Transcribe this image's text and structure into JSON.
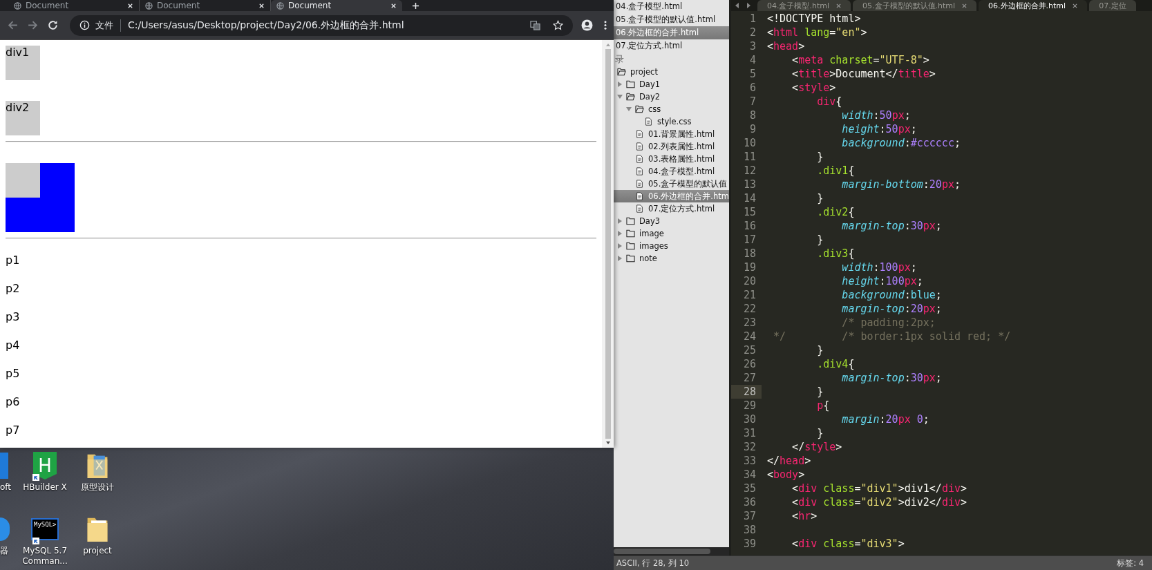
{
  "browser": {
    "tabs": [
      {
        "title": "Document",
        "selected": false
      },
      {
        "title": "Document",
        "selected": false
      },
      {
        "title": "Document",
        "selected": true
      }
    ],
    "address": {
      "scheme_label": "文件",
      "url": "C:/Users/asus/Desktop/project/Day2/06.外边框的合并.html"
    },
    "page": [
      {
        "kind": "box",
        "text": "div1"
      },
      {
        "kind": "box",
        "text": "div2"
      },
      {
        "kind": "rule"
      },
      {
        "kind": "nested"
      },
      {
        "kind": "rule"
      },
      {
        "kind": "para",
        "text": "p1"
      },
      {
        "kind": "para",
        "text": "p2"
      },
      {
        "kind": "para",
        "text": "p3"
      },
      {
        "kind": "para",
        "text": "p4"
      },
      {
        "kind": "para",
        "text": "p5"
      },
      {
        "kind": "para",
        "text": "p6"
      },
      {
        "kind": "para",
        "text": "p7"
      }
    ]
  },
  "desktop": {
    "icons": [
      {
        "label": "oft",
        "kind": "app-square",
        "shortcut": false
      },
      {
        "label": "HBuilder X",
        "kind": "hexagon",
        "glyph": "H",
        "shortcut": true
      },
      {
        "label": "原型设计",
        "kind": "doc-folder",
        "shortcut": false
      },
      {
        "label": "器",
        "kind": "app-circle",
        "shortcut": false
      },
      {
        "label": "MySQL 5.7 Comman...",
        "kind": "terminal",
        "glyph": "MySQL>",
        "shortcut": true
      },
      {
        "label": "project",
        "kind": "folder",
        "shortcut": false
      }
    ]
  },
  "sublime": {
    "open_files": [
      {
        "name": "04.盒子模型.html",
        "selected": false
      },
      {
        "name": "05.盒子模型的默认值.html",
        "selected": false
      },
      {
        "name": "06.外边框的合并.html",
        "selected": true
      },
      {
        "name": "07.定位方式.html",
        "selected": false
      }
    ],
    "folders_header": "录",
    "tree": [
      {
        "name": "project",
        "kind": "folder",
        "expanded": true,
        "selected": false,
        "children": [
          {
            "name": "Day1",
            "kind": "folder",
            "expanded": false,
            "selected": false
          },
          {
            "name": "Day2",
            "kind": "folder",
            "expanded": true,
            "selected": false,
            "children": [
              {
                "name": "css",
                "kind": "folder",
                "expanded": true,
                "selected": false,
                "children": [
                  {
                    "name": "style.css",
                    "kind": "file",
                    "selected": false
                  }
                ]
              },
              {
                "name": "01.背景属性.html",
                "kind": "file",
                "selected": false
              },
              {
                "name": "02.列表属性.html",
                "kind": "file",
                "selected": false
              },
              {
                "name": "03.表格属性.html",
                "kind": "file",
                "selected": false
              },
              {
                "name": "04.盒子模型.html",
                "kind": "file",
                "selected": false
              },
              {
                "name": "05.盒子模型的默认值",
                "kind": "file",
                "selected": false
              },
              {
                "name": "06.外边框的合并.htm",
                "kind": "file",
                "selected": true
              },
              {
                "name": "07.定位方式.html",
                "kind": "file",
                "selected": false
              }
            ]
          },
          {
            "name": "Day3",
            "kind": "folder",
            "expanded": false,
            "selected": false
          },
          {
            "name": "image",
            "kind": "folder",
            "expanded": false,
            "selected": false
          },
          {
            "name": "images",
            "kind": "folder",
            "expanded": false,
            "selected": false
          },
          {
            "name": "note",
            "kind": "folder",
            "expanded": false,
            "selected": false
          }
        ]
      }
    ],
    "editor": {
      "tabs": [
        {
          "title": "04.盒子模型.html",
          "selected": false,
          "closable": true
        },
        {
          "title": "05.盒子模型的默认值.html",
          "selected": false,
          "closable": true
        },
        {
          "title": "06.外边框的合并.html",
          "selected": true,
          "closable": true
        },
        {
          "title": "07.定位",
          "selected": false,
          "closable": false
        }
      ],
      "lines": [
        {
          "n": "1",
          "current": false,
          "tokens": [
            {
              "kind": "p",
              "text": "<!DOCTYPE html>"
            }
          ]
        },
        {
          "n": "2",
          "current": false,
          "tokens": [
            {
              "kind": "p",
              "text": "<"
            },
            {
              "kind": "tag",
              "text": "html"
            },
            {
              "kind": "attr",
              "text": " lang"
            },
            {
              "kind": "p",
              "text": "="
            },
            {
              "kind": "str",
              "text": "\"en\""
            },
            {
              "kind": "p",
              "text": ">"
            }
          ]
        },
        {
          "n": "3",
          "current": false,
          "tokens": [
            {
              "kind": "p",
              "text": "<"
            },
            {
              "kind": "tag",
              "text": "head"
            },
            {
              "kind": "p",
              "text": ">"
            }
          ]
        },
        {
          "n": "4",
          "current": false,
          "tokens": [
            {
              "kind": "p",
              "text": "    <"
            },
            {
              "kind": "tag",
              "text": "meta"
            },
            {
              "kind": "attr",
              "text": " charset"
            },
            {
              "kind": "p",
              "text": "="
            },
            {
              "kind": "str",
              "text": "\"UTF-8\""
            },
            {
              "kind": "p",
              "text": ">"
            }
          ]
        },
        {
          "n": "5",
          "current": false,
          "tokens": [
            {
              "kind": "p",
              "text": "    <"
            },
            {
              "kind": "tag",
              "text": "title"
            },
            {
              "kind": "p",
              "text": ">Document</"
            },
            {
              "kind": "tag",
              "text": "title"
            },
            {
              "kind": "p",
              "text": ">"
            }
          ]
        },
        {
          "n": "6",
          "current": false,
          "tokens": [
            {
              "kind": "p",
              "text": "    <"
            },
            {
              "kind": "tag",
              "text": "style"
            },
            {
              "kind": "p",
              "text": ">"
            }
          ]
        },
        {
          "n": "7",
          "current": false,
          "tokens": [
            {
              "kind": "tag",
              "text": "        div"
            },
            {
              "kind": "p",
              "text": "{"
            }
          ]
        },
        {
          "n": "8",
          "current": false,
          "tokens": [
            {
              "kind": "prop",
              "text": "            width"
            },
            {
              "kind": "p",
              "text": ":"
            },
            {
              "kind": "num",
              "text": "50"
            },
            {
              "kind": "unit",
              "text": "px"
            },
            {
              "kind": "p",
              "text": ";"
            }
          ]
        },
        {
          "n": "9",
          "current": false,
          "tokens": [
            {
              "kind": "prop",
              "text": "            height"
            },
            {
              "kind": "p",
              "text": ":"
            },
            {
              "kind": "num",
              "text": "50"
            },
            {
              "kind": "unit",
              "text": "px"
            },
            {
              "kind": "p",
              "text": ";"
            }
          ]
        },
        {
          "n": "10",
          "current": false,
          "tokens": [
            {
              "kind": "prop",
              "text": "            background"
            },
            {
              "kind": "p",
              "text": ":"
            },
            {
              "kind": "num",
              "text": "#cccccc"
            },
            {
              "kind": "p",
              "text": ";"
            }
          ]
        },
        {
          "n": "11",
          "current": false,
          "tokens": [
            {
              "kind": "p",
              "text": "        }"
            }
          ]
        },
        {
          "n": "12",
          "current": false,
          "tokens": [
            {
              "kind": "sel",
              "text": "        .div1"
            },
            {
              "kind": "p",
              "text": "{"
            }
          ]
        },
        {
          "n": "13",
          "current": false,
          "tokens": [
            {
              "kind": "prop",
              "text": "            margin-bottom"
            },
            {
              "kind": "p",
              "text": ":"
            },
            {
              "kind": "num",
              "text": "20"
            },
            {
              "kind": "unit",
              "text": "px"
            },
            {
              "kind": "p",
              "text": ";"
            }
          ]
        },
        {
          "n": "14",
          "current": false,
          "tokens": [
            {
              "kind": "p",
              "text": "        }"
            }
          ]
        },
        {
          "n": "15",
          "current": false,
          "tokens": [
            {
              "kind": "sel",
              "text": "        .div2"
            },
            {
              "kind": "p",
              "text": "{"
            }
          ]
        },
        {
          "n": "16",
          "current": false,
          "tokens": [
            {
              "kind": "prop",
              "text": "            margin-top"
            },
            {
              "kind": "p",
              "text": ":"
            },
            {
              "kind": "num",
              "text": "30"
            },
            {
              "kind": "unit",
              "text": "px"
            },
            {
              "kind": "p",
              "text": ";"
            }
          ]
        },
        {
          "n": "17",
          "current": false,
          "tokens": [
            {
              "kind": "p",
              "text": "        }"
            }
          ]
        },
        {
          "n": "18",
          "current": false,
          "tokens": [
            {
              "kind": "sel",
              "text": "        .div3"
            },
            {
              "kind": "p",
              "text": "{"
            }
          ]
        },
        {
          "n": "19",
          "current": false,
          "tokens": [
            {
              "kind": "prop",
              "text": "            width"
            },
            {
              "kind": "p",
              "text": ":"
            },
            {
              "kind": "num",
              "text": "100"
            },
            {
              "kind": "unit",
              "text": "px"
            },
            {
              "kind": "p",
              "text": ";"
            }
          ]
        },
        {
          "n": "20",
          "current": false,
          "tokens": [
            {
              "kind": "prop",
              "text": "            height"
            },
            {
              "kind": "p",
              "text": ":"
            },
            {
              "kind": "num",
              "text": "100"
            },
            {
              "kind": "unit",
              "text": "px"
            },
            {
              "kind": "p",
              "text": ";"
            }
          ]
        },
        {
          "n": "21",
          "current": false,
          "tokens": [
            {
              "kind": "prop",
              "text": "            background"
            },
            {
              "kind": "p",
              "text": ":"
            },
            {
              "kind": "kw",
              "text": "blue"
            },
            {
              "kind": "p",
              "text": ";"
            }
          ]
        },
        {
          "n": "22",
          "current": false,
          "tokens": [
            {
              "kind": "prop",
              "text": "            margin-top"
            },
            {
              "kind": "p",
              "text": ":"
            },
            {
              "kind": "num",
              "text": "20"
            },
            {
              "kind": "unit",
              "text": "px"
            },
            {
              "kind": "p",
              "text": ";"
            }
          ]
        },
        {
          "n": "23",
          "current": false,
          "tokens": [
            {
              "kind": "cmt",
              "text": "            /* padding:2px;"
            }
          ]
        },
        {
          "n": "24",
          "current": false,
          "tokens": [
            {
              "kind": "cmt",
              "text": " */         /* border:1px solid red; */"
            }
          ]
        },
        {
          "n": "25",
          "current": false,
          "tokens": [
            {
              "kind": "p",
              "text": "        }"
            }
          ]
        },
        {
          "n": "26",
          "current": false,
          "tokens": [
            {
              "kind": "sel",
              "text": "        .div4"
            },
            {
              "kind": "p",
              "text": "{"
            }
          ]
        },
        {
          "n": "27",
          "current": false,
          "tokens": [
            {
              "kind": "prop",
              "text": "            margin-top"
            },
            {
              "kind": "p",
              "text": ":"
            },
            {
              "kind": "num",
              "text": "30"
            },
            {
              "kind": "unit",
              "text": "px"
            },
            {
              "kind": "p",
              "text": ";"
            }
          ]
        },
        {
          "n": "28",
          "current": true,
          "tokens": [
            {
              "kind": "p",
              "text": "        }"
            }
          ]
        },
        {
          "n": "29",
          "current": false,
          "tokens": [
            {
              "kind": "tag",
              "text": "        p"
            },
            {
              "kind": "p",
              "text": "{"
            }
          ]
        },
        {
          "n": "30",
          "current": false,
          "tokens": [
            {
              "kind": "prop",
              "text": "            margin"
            },
            {
              "kind": "p",
              "text": ":"
            },
            {
              "kind": "num",
              "text": "20"
            },
            {
              "kind": "unit",
              "text": "px"
            },
            {
              "kind": "num",
              "text": " 0"
            },
            {
              "kind": "p",
              "text": ";"
            }
          ]
        },
        {
          "n": "31",
          "current": false,
          "tokens": [
            {
              "kind": "p",
              "text": "        }"
            }
          ]
        },
        {
          "n": "32",
          "current": false,
          "tokens": [
            {
              "kind": "p",
              "text": "    </"
            },
            {
              "kind": "tag",
              "text": "style"
            },
            {
              "kind": "p",
              "text": ">"
            }
          ]
        },
        {
          "n": "33",
          "current": false,
          "tokens": [
            {
              "kind": "p",
              "text": "</"
            },
            {
              "kind": "tag",
              "text": "head"
            },
            {
              "kind": "p",
              "text": ">"
            }
          ]
        },
        {
          "n": "34",
          "current": false,
          "tokens": [
            {
              "kind": "p",
              "text": "<"
            },
            {
              "kind": "tag",
              "text": "body"
            },
            {
              "kind": "p",
              "text": ">"
            }
          ]
        },
        {
          "n": "35",
          "current": false,
          "tokens": [
            {
              "kind": "p",
              "text": "    <"
            },
            {
              "kind": "tag",
              "text": "div"
            },
            {
              "kind": "attr",
              "text": " class"
            },
            {
              "kind": "p",
              "text": "="
            },
            {
              "kind": "str",
              "text": "\"div1\""
            },
            {
              "kind": "p",
              "text": ">div1</"
            },
            {
              "kind": "tag",
              "text": "div"
            },
            {
              "kind": "p",
              "text": ">"
            }
          ]
        },
        {
          "n": "36",
          "current": false,
          "tokens": [
            {
              "kind": "p",
              "text": "    <"
            },
            {
              "kind": "tag",
              "text": "div"
            },
            {
              "kind": "attr",
              "text": " class"
            },
            {
              "kind": "p",
              "text": "="
            },
            {
              "kind": "str",
              "text": "\"div2\""
            },
            {
              "kind": "p",
              "text": ">div2</"
            },
            {
              "kind": "tag",
              "text": "div"
            },
            {
              "kind": "p",
              "text": ">"
            }
          ]
        },
        {
          "n": "37",
          "current": false,
          "tokens": [
            {
              "kind": "p",
              "text": "    <"
            },
            {
              "kind": "tag",
              "text": "hr"
            },
            {
              "kind": "p",
              "text": ">"
            }
          ]
        },
        {
          "n": "38",
          "current": false
        },
        {
          "n": "39",
          "current": false,
          "tokens": [
            {
              "kind": "p",
              "text": "    <"
            },
            {
              "kind": "tag",
              "text": "div"
            },
            {
              "kind": "attr",
              "text": " class"
            },
            {
              "kind": "p",
              "text": "="
            },
            {
              "kind": "str",
              "text": "\"div3\""
            },
            {
              "kind": "p",
              "text": ">"
            }
          ]
        }
      ]
    },
    "status_bar": {
      "left": "ASCII, 行 28, 列 10",
      "right": "标签: 4"
    }
  }
}
